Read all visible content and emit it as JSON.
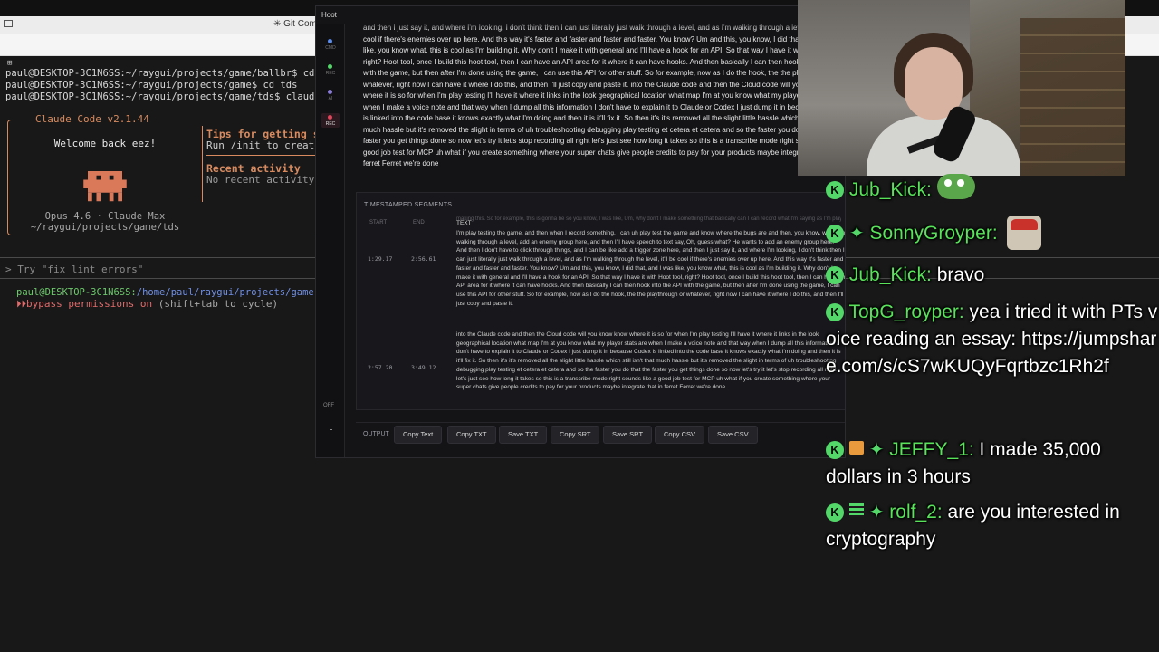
{
  "browser": {
    "tab_label": "Git Com"
  },
  "terminal": {
    "lines": [
      "paul@DESKTOP-3C1N6SS:~/raygui/projects/game/ballbr$ cd ..",
      "paul@DESKTOP-3C1N6SS:~/raygui/projects/game$ cd tds",
      "paul@DESKTOP-3C1N6SS:~/raygui/projects/game/tds$ claud"
    ],
    "claude_title": "Claude Code v2.1.44",
    "welcome": "Welcome back eez!",
    "model": "Opus 4.6 · Claude Max",
    "cwd": "~/raygui/projects/game/tds",
    "tips_title": "Tips for getting st",
    "tips_text": "Run /init to create",
    "recent_title": "Recent activity",
    "recent_text": "No recent activity",
    "try_hint": "> Try \"fix lint errors\"",
    "prompt_user": "paul@DESKTOP-3C1N6SS:",
    "prompt_path": "/home/paul/raygui/projects/game",
    "bypass": "bypass permissions on",
    "bypass_hint": " (shift+tab to cycle)",
    "colors": {
      "accent": "#d98b5f",
      "user": "#6bc96b",
      "path": "#6f8fe6",
      "bypass": "#e36a6a"
    }
  },
  "hoot": {
    "title": "Hoot",
    "side": [
      {
        "label": "CMD",
        "dot": "#5b8def"
      },
      {
        "label": "REC",
        "dot": "#53d769"
      },
      {
        "label": "AI",
        "dot": "#8a7bd8"
      },
      {
        "label": "REC",
        "dot": "#e0455a"
      }
    ],
    "toggle_label": "OFF",
    "transcript": "and then I just say it, and where I'm looking, I don't think then I can just literally just walk through a level, and as I'm walking through a level, it'll be cool if there's enemies over up here. And this way it's faster and faster and faster and faster. You know? Um and this, you know, I did that, and I was like, you know what, this is cool as I'm building it. Why don't I make it with general and I'll have a hook for an API. So that way I have it with Hoot tool, right? Hoot tool, once I build this hoot tool, then I can have an API area for it where it can have hooks. And then basically I can then hook into the API with the game, but then after I'm done using the game, I can use this API for other stuff. So for example, now as I do the hook, the the playthrough or whatever, right now I can have it where I do this, and then I'll just copy and paste it. into the Claude code and then the Cloud code will you know know where it is so for when I'm play testing I'll have it where it links in the look geographical location what map I'm at you know what my player stats are when I make a voice note and that way when I dump all this information I don't have to explain it to Claude or Codex I just dump it in because Codex is linked into the code base it knows exactly what I'm doing and then it is it'll fix it. So then it's it's removed all the slight little hassle which still isn't that much hassle but it's removed the slight in terms of uh troubleshooting debugging play testing et cetera et cetera and so the faster you do that the faster you get things done so now let's try it let's stop recording all right let's just see how long it takes so this is a transcribe mode right sounds like a good job test for MCP uh what if you create something where your super chats give people credits to pay for your products maybe integrate that in ferret Ferret we're done",
    "segments_title": "TIMESTAMPED SEGMENTS",
    "col_start": "START",
    "col_end": "END",
    "col_text": "TEXT",
    "segment_ghost": "making this. So for example, this is gonna be so you know, I was like, Um, why don't I make something that basically can I can record what I'm saying as I'm play testing the game, and then when I record something, I can uh play test the game and know where the bugs are and then walk",
    "segments": [
      {
        "start": "1:29.17",
        "end": "2:56.61",
        "text": "I'm play testing the game, and then when I record something, I can uh play test the game and know where the bugs are and then, you know, while I'm walking through a level, add an enemy group here, and then I'll have speech to text say, Oh, guess what? He wants to add an enemy group here. And then I don't have to click through things, and I can be like add a trigger zone here, and then I just say it, and where I'm looking, I don't think then I can just literally just walk through a level, and as I'm walking through the level, it'll be cool if there's enemies over up here. And this way it's faster and faster and faster and faster. You know? Um and this, you know, I did that, and I was like, you know what, this is cool as I'm building it. Why don't I make it with general and I'll have a hook for an API. So that way I have it with Hoot tool, right? Hoot tool, once I build this hoot tool, then I can have an API area for it where it can have hooks. And then basically I can then hook into the API with the game, but then after I'm done using the game, I can use this API for other stuff. So for example, now as I do the hook, the the playthrough or whatever, right now I can have it where I do this, and then I'll just copy and paste it."
      },
      {
        "start": "2:57.20",
        "end": "3:49.12",
        "text": "into the Claude code and then the Cloud code will you know know where it is so for when I'm play testing I'll have it where it links in the look geographical location what map I'm at you know what my player stats are when I make a voice note and that way when I dump all this information I don't have to explain it to Claude or Codex I just dump it in because Codex is linked into the code base it knows exactly what I'm doing and then it is it'll fix it. So then it's it's removed all the slight little hassle which still isn't that much hassle but it's removed the slight in terms of uh troubleshooting debugging play testing et cetera et cetera and so the faster you do that the faster you get things done so now let's try it let's stop recording all right let's just see how long it takes so this is a transcribe mode right sounds like a good job test for MCP uh what if you create something where your super chats give people credits to pay for your products maybe integrate that in ferret Ferret we're done"
      }
    ],
    "output_label": "OUTPUT",
    "buttons": [
      "Copy Text",
      "Copy TXT",
      "Save TXT",
      "Copy SRT",
      "Save SRT",
      "Copy CSV",
      "Save CSV"
    ]
  },
  "chat": {
    "messages": [
      {
        "user": "Jub_Kick:",
        "text": "",
        "badges": [
          "mod"
        ],
        "emote": "pepe"
      },
      {
        "user": "SonnyGroyper:",
        "text": "",
        "badges": [
          "mod",
          "sub"
        ],
        "emote": "rat"
      },
      {
        "user": "Jub_Kick:",
        "text": "bravo",
        "badges": [
          "mod"
        ]
      },
      {
        "user": "TopG_royper:",
        "text": "yea i tried it with PTs voice reading an essay: https://jumpshare.com/s/cS7wKUQyFqrtbzc1Rh2f",
        "badges": [
          "mod"
        ]
      },
      {
        "user": "JEFFY_1:",
        "text": "I made 35,000 dollars in 3 hours",
        "badges": [
          "mod",
          "gift",
          "sub"
        ]
      },
      {
        "user": "rolf_2:",
        "text": "are you interested in cryptography",
        "badges": [
          "mod",
          "grid",
          "sub"
        ]
      }
    ],
    "colors": {
      "username": "#58e35a",
      "badge": "#53d769"
    }
  }
}
